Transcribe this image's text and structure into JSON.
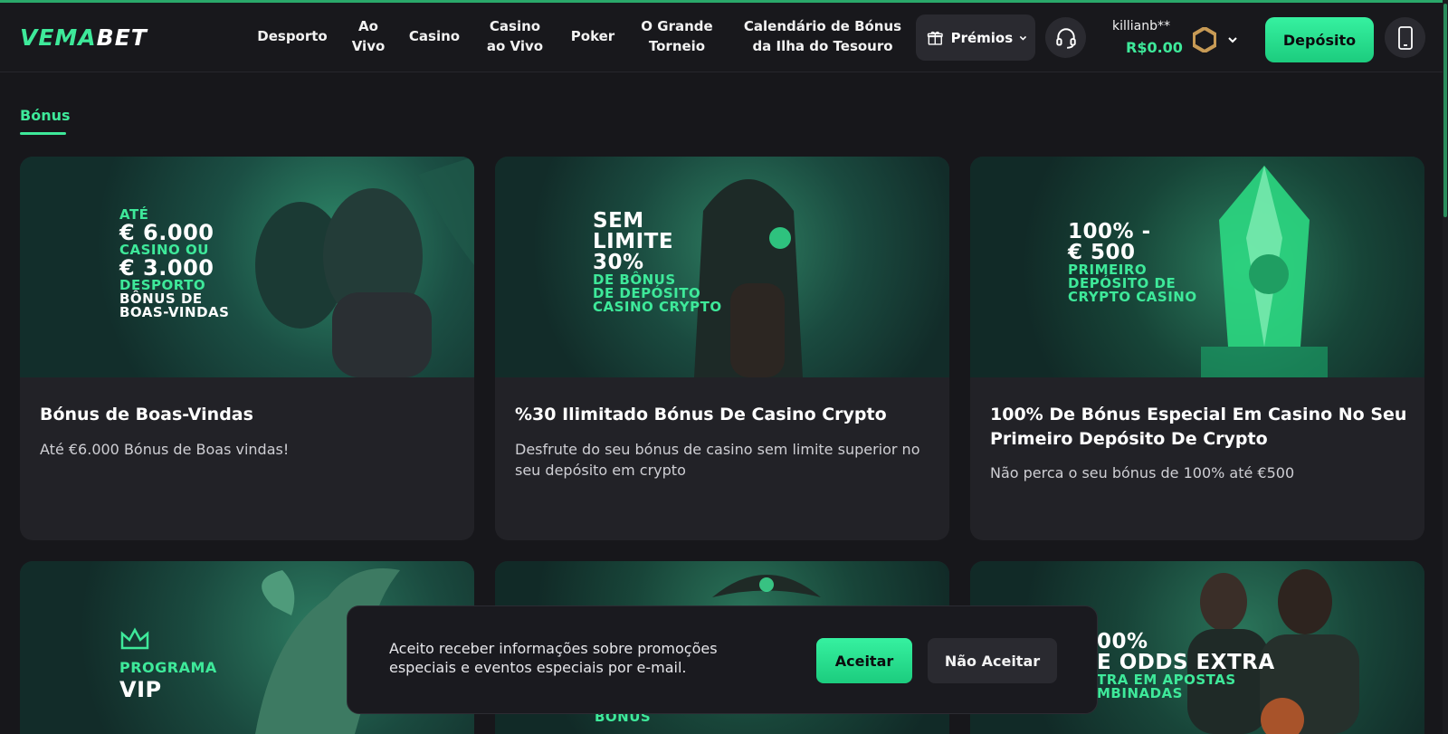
{
  "header": {
    "logo_left": "VEMA",
    "logo_right": "BET",
    "nav": [
      {
        "label": "Desporto"
      },
      {
        "label": "Ao Vivo"
      },
      {
        "label": "Casino"
      },
      {
        "label": "Casino ao Vivo"
      },
      {
        "label": "Poker"
      },
      {
        "label": "O Grande Torneio"
      },
      {
        "label": "Calendário de Bónus da Ilha do Tesouro"
      }
    ],
    "prizes_label": "Prémios",
    "username": "killianb**",
    "balance": "R$0.00",
    "deposit_label": "Depósito"
  },
  "page": {
    "tab_label": "Bónus"
  },
  "cards": [
    {
      "title": "Bónus de Boas-Vindas",
      "description": "Até €6.000 Bónus de Boas vindas!",
      "promo": [
        "ATÉ",
        "€ 6.000",
        "CASINO OU",
        "€ 3.000",
        "DESPORTO",
        "BÔNUS DE",
        "BOAS-VINDAS"
      ]
    },
    {
      "title": "%30 Ilimitado Bónus De Casino Crypto",
      "description": "Desfrute do seu bónus de casino sem limite superior no seu depósito em crypto",
      "promo": [
        "SEM",
        "LIMITE",
        "30%",
        "DE BÔNUS",
        "DE DEPÓSITO",
        "CASINO CRYPTO"
      ]
    },
    {
      "title": "100% De Bónus Especial Em Casino No Seu Primeiro Depósito De Crypto",
      "description": "Não perca o seu bónus de 100% até €500",
      "promo": [
        "100% -",
        "€ 500",
        "PRIMEIRO",
        "DEPÓSITO DE",
        "CRYPTO CASINO"
      ]
    },
    {
      "promo": [
        "PROGRAMA",
        "VIP"
      ]
    },
    {
      "promo": [
        "BONUS"
      ]
    },
    {
      "promo": [
        "00%",
        "E ODDS EXTRA",
        "TRA EM APOSTAS",
        "MBINADAS"
      ]
    }
  ],
  "cookie": {
    "text": "Aceito receber informações sobre promoções especiais e eventos especiais por e-mail.",
    "accept_label": "Aceitar",
    "decline_label": "Não Aceitar"
  },
  "colors": {
    "accent": "#3ee99a",
    "background": "#17171b",
    "card": "#222227"
  }
}
